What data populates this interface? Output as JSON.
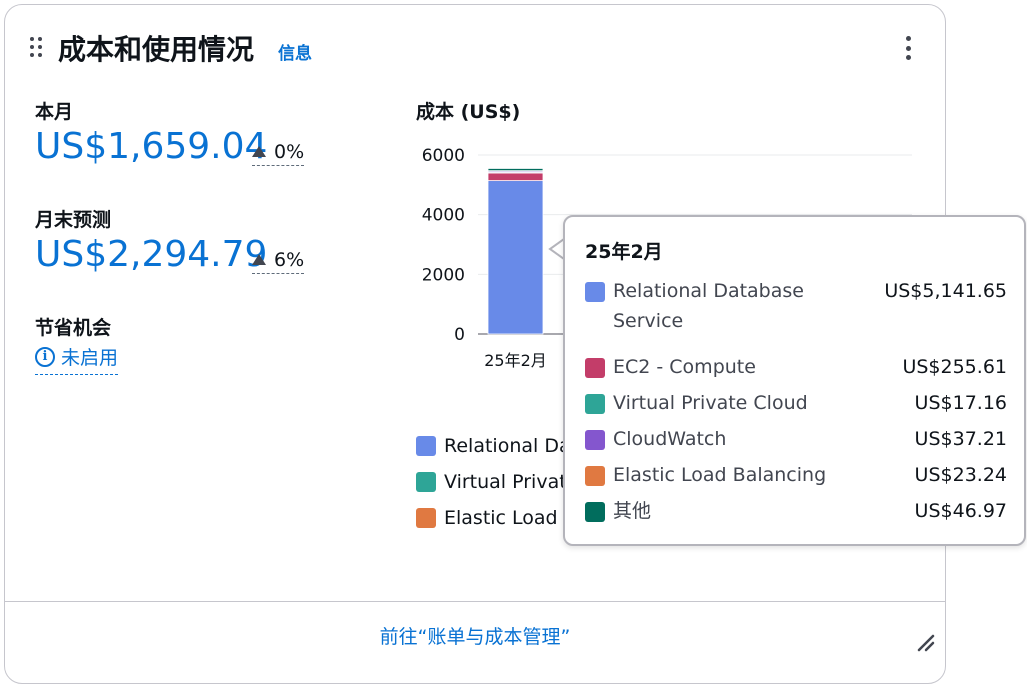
{
  "widget": {
    "title": "成本和使用情况",
    "info_link": "信息"
  },
  "metrics": {
    "this_month": {
      "label": "本月",
      "value": "US$1,659.04",
      "change": "0%"
    },
    "forecast": {
      "label": "月末预测",
      "value": "US$2,294.79",
      "change": "6%"
    },
    "savings": {
      "label": "节省机会",
      "status": "未启用"
    }
  },
  "chart_data": {
    "type": "bar",
    "title": "成本 (US$)",
    "categories": [
      "25年2月"
    ],
    "stacked": true,
    "ylim": [
      0,
      6000
    ],
    "yticks": [
      0,
      2000,
      4000,
      6000
    ],
    "grid": true,
    "series": [
      {
        "name": "Relational Database Service",
        "values": [
          5141.65
        ],
        "color": "#688ae8"
      },
      {
        "name": "EC2 - Compute",
        "values": [
          255.61
        ],
        "color": "#c33d69"
      },
      {
        "name": "Virtual Private Cloud",
        "values": [
          17.16
        ],
        "color": "#2ea597"
      },
      {
        "name": "CloudWatch",
        "values": [
          37.21
        ],
        "color": "#8456ce"
      },
      {
        "name": "Elastic Load Balancing",
        "values": [
          23.24
        ],
        "color": "#e07941"
      },
      {
        "name": "其他",
        "values": [
          46.97
        ],
        "color": "#016d5d"
      }
    ],
    "legend": {
      "placement": "bottom",
      "visible_labels": [
        "Relational Da",
        "Virtual Privat",
        "Elastic Load"
      ]
    }
  },
  "tooltip": {
    "title": "25年2月",
    "rows": [
      {
        "name": "Relational Database Service",
        "value": "US$5,141.65",
        "color": "#688ae8"
      },
      {
        "name": "EC2 - Compute",
        "value": "US$255.61",
        "color": "#c33d69"
      },
      {
        "name": "Virtual Private Cloud",
        "value": "US$17.16",
        "color": "#2ea597"
      },
      {
        "name": "CloudWatch",
        "value": "US$37.21",
        "color": "#8456ce"
      },
      {
        "name": "Elastic Load Balancing",
        "value": "US$23.24",
        "color": "#e07941"
      },
      {
        "name": "其他",
        "value": "US$46.97",
        "color": "#016d5d"
      }
    ]
  },
  "footer": {
    "link": "前往“账单与成本管理”"
  },
  "colors": {
    "link": "#0972d3",
    "text": "#0f141a",
    "border": "#c6c6cd"
  }
}
